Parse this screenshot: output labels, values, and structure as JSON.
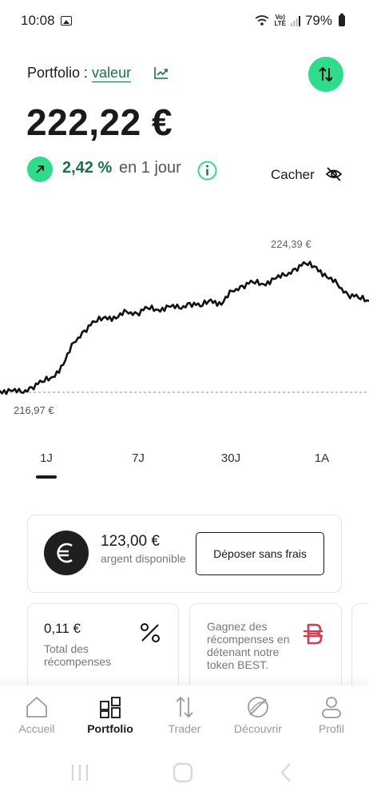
{
  "status_bar": {
    "time": "10:08",
    "lte_top": "Vo)",
    "lte_bottom": "LTE",
    "battery": "79%"
  },
  "header": {
    "label": "Portfolio : ",
    "mode_link": "valeur",
    "trend_icon": "trend-up-icon",
    "swap_icon": "swap-vertical-icon"
  },
  "balance": {
    "amount": "222,22 €",
    "change_pct": "2,42 %",
    "change_period": "en 1 jour",
    "hide_label": "Cacher"
  },
  "chart_data": {
    "type": "line",
    "high_label": "224,39 €",
    "low_label": "216,97 €",
    "series": [
      {
        "values": [
          216.97,
          217.0,
          216.9,
          217.2,
          217.5,
          217.8,
          218.5,
          219.8,
          220.5,
          221.0,
          221.3,
          221.2,
          221.6,
          221.5,
          221.8,
          221.7,
          221.9,
          221.8,
          222.1,
          221.9,
          222.3,
          222.0,
          222.8,
          223.1,
          223.3,
          223.2,
          223.5,
          223.7,
          224.1,
          224.39,
          224.2,
          223.6,
          223.2,
          222.6,
          222.4,
          222.22
        ]
      }
    ],
    "colors": {
      "line": "#111111",
      "baseline": "#a6a6a6"
    }
  },
  "ranges": {
    "tabs": [
      "1J",
      "7J",
      "30J",
      "1A"
    ],
    "active": "1J"
  },
  "cash": {
    "amount": "123,00 €",
    "caption": "argent disponible",
    "deposit_label": "Déposer sans frais"
  },
  "rewards": {
    "value": "0,11 €",
    "caption": "Total des récompenses"
  },
  "best_card": {
    "text": "Gagnez des récompenses en détenant notre token BEST."
  },
  "nav": {
    "items": [
      {
        "label": "Accueil",
        "icon": "home-icon"
      },
      {
        "label": "Portfolio",
        "icon": "portfolio-icon"
      },
      {
        "label": "Trader",
        "icon": "trade-arrows-icon"
      },
      {
        "label": "Découvrir",
        "icon": "discover-icon"
      },
      {
        "label": "Profil",
        "icon": "profile-icon"
      }
    ],
    "active": "Portfolio"
  },
  "colors": {
    "accent": "#2fdc8b",
    "positive_text": "#13734c",
    "best_red": "#d93a4e"
  }
}
